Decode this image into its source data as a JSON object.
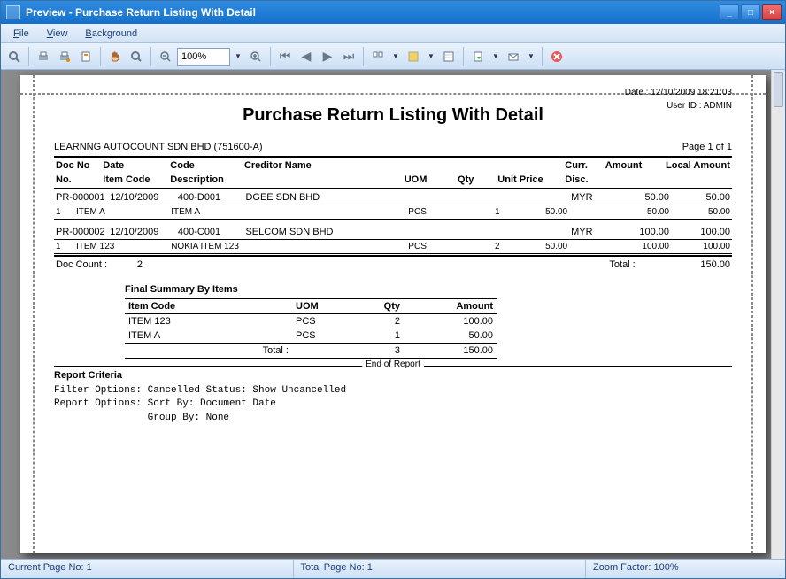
{
  "window": {
    "title": "Preview - Purchase Return Listing With Detail"
  },
  "menu": {
    "file": "File",
    "view": "View",
    "background": "Background"
  },
  "toolbar": {
    "zoom_value": "100%"
  },
  "report": {
    "date_label": "Date :",
    "date_value": "12/10/2009 18:21:03",
    "user_label": "User ID :",
    "user_value": "ADMIN",
    "title": "Purchase Return Listing With Detail",
    "company": "LEARNNG AUTOCOUNT SDN BHD (751600-A)",
    "page": "Page 1 of 1",
    "doc_count_label": "Doc Count :",
    "doc_count_value": "2",
    "total_label": "Total :",
    "total_value": "150.00",
    "end_of_report": "End of Report",
    "criteria_title": "Report Criteria",
    "criteria_body": "Filter Options: Cancelled Status: Show Uncancelled\nReport Options: Sort By: Document Date\n                Group By: None"
  },
  "headers1": {
    "doc_no": "Doc No",
    "date": "Date",
    "code": "Code",
    "creditor_name": "Creditor Name",
    "curr": "Curr.",
    "amount": "Amount",
    "local_amount": "Local Amount"
  },
  "headers2": {
    "no": "No.",
    "item_code": "Item Code",
    "description": "Description",
    "uom": "UOM",
    "qty": "Qty",
    "unit_price": "Unit Price",
    "disc": "Disc."
  },
  "docs": [
    {
      "doc_no": "PR-000001",
      "date": "12/10/2009",
      "code": "400-D001",
      "creditor_name": "DGEE SDN BHD",
      "curr": "MYR",
      "amount": "50.00",
      "local_amount": "50.00",
      "items": [
        {
          "no": "1",
          "item_code": "ITEM A",
          "description": "ITEM A",
          "uom": "PCS",
          "qty": "1",
          "unit_price": "50.00",
          "amount": "50.00",
          "local_amount": "50.00"
        }
      ]
    },
    {
      "doc_no": "PR-000002",
      "date": "12/10/2009",
      "code": "400-C001",
      "creditor_name": "SELCOM SDN BHD",
      "curr": "MYR",
      "amount": "100.00",
      "local_amount": "100.00",
      "items": [
        {
          "no": "1",
          "item_code": "ITEM 123",
          "description": "NOKIA ITEM 123",
          "uom": "PCS",
          "qty": "2",
          "unit_price": "50.00",
          "amount": "100.00",
          "local_amount": "100.00"
        }
      ]
    }
  ],
  "summary": {
    "title": "Final Summary By Items",
    "headers": {
      "item_code": "Item Code",
      "uom": "UOM",
      "qty": "Qty",
      "amount": "Amount"
    },
    "rows": [
      {
        "item_code": "ITEM 123",
        "uom": "PCS",
        "qty": "2",
        "amount": "100.00"
      },
      {
        "item_code": "ITEM A",
        "uom": "PCS",
        "qty": "1",
        "amount": "50.00"
      }
    ],
    "total_label": "Total :",
    "total_qty": "3",
    "total_amount": "150.00"
  },
  "status": {
    "current_page": "Current Page No: 1",
    "total_page": "Total Page No: 1",
    "zoom_factor": "Zoom Factor: 100%"
  }
}
